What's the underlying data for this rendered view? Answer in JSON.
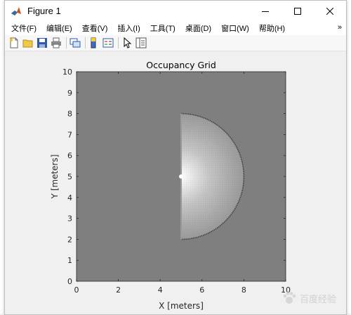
{
  "window": {
    "title": "Figure 1"
  },
  "menu": {
    "items": [
      "文件(F)",
      "编辑(E)",
      "查看(V)",
      "插入(I)",
      "工具(T)",
      "桌面(D)",
      "窗口(W)",
      "帮助(H)"
    ],
    "overflow_arrow": "»"
  },
  "toolbar": {
    "buttons": [
      "new-figure-icon",
      "open-file-icon",
      "save-icon",
      "print-icon",
      "link-plot-icon",
      "insert-colorbar-icon",
      "insert-legend-icon",
      "edit-plot-arrow-icon",
      "property-inspector-icon"
    ]
  },
  "chart_data": {
    "type": "heatmap",
    "title": "Occupancy Grid",
    "xlabel": "X [meters]",
    "ylabel": "Y [meters]",
    "xlim": [
      0,
      10
    ],
    "ylim": [
      0,
      10
    ],
    "xticks": [
      "0",
      "2",
      "4",
      "6",
      "8",
      "10"
    ],
    "yticks": [
      "0",
      "1",
      "2",
      "3",
      "4",
      "5",
      "6",
      "7",
      "8",
      "9",
      "10"
    ],
    "colormap": "gray",
    "unknown_occupancy_color": "#7f7f7f",
    "sensor_position": [
      5,
      5
    ],
    "scan_range": 3,
    "scan_angles_deg": [
      -90,
      90
    ],
    "free_space_color": "#ffffff",
    "occupied_boundary_color": "#404040"
  },
  "watermark": {
    "text": "百度经验"
  }
}
